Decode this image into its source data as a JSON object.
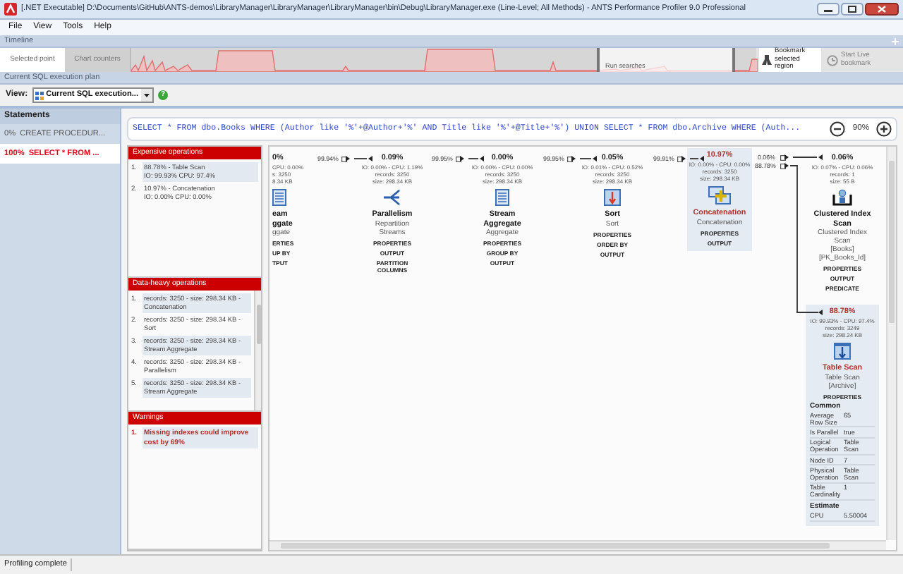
{
  "window": {
    "title": "[.NET Executable] D:\\Documents\\GitHub\\ANTS-demos\\LibraryManager\\LibraryManager\\LibraryManager\\bin\\Debug\\LibraryManager.exe (Line-Level; All Methods) - ANTS Performance Profiler 9.0 Professional"
  },
  "menu": [
    "File",
    "View",
    "Tools",
    "Help"
  ],
  "timeline": {
    "title": "Timeline",
    "tabs": [
      {
        "label": "Selected point",
        "selected": true
      },
      {
        "label": "Chart counters",
        "selected": false
      }
    ],
    "region_label": "Run searches",
    "buttons": [
      {
        "label": "Bookmark selected region",
        "disabled": false
      },
      {
        "label": "Start Live bookmark",
        "disabled": true
      }
    ]
  },
  "plan_title": "Current SQL execution plan",
  "view": {
    "label": "View:",
    "value": "Current SQL execution...",
    "help": "?"
  },
  "statements": {
    "title": "Statements",
    "items": [
      {
        "percent": "0%",
        "text": "CREATE PROCEDUR...",
        "selected": false
      },
      {
        "percent": "100%",
        "text": "SELECT * FROM ...",
        "selected": true
      }
    ]
  },
  "query": {
    "sql": "SELECT * FROM dbo.Books WHERE (Author like '%'+@Author+'%' AND Title like '%'+@Title+'%') UNION SELECT * FROM dbo.Archive WHERE (Auth...",
    "zoom": "90%"
  },
  "panels": [
    {
      "kind": "operations",
      "title": "Expensive operations",
      "items": [
        {
          "number": "1.",
          "text": "88.78% - Table Scan",
          "detail": "IO: 99.93% CPU: 97.4%"
        },
        {
          "number": "2.",
          "text": "10.97% - Concatenation",
          "detail": "IO: 0.00% CPU: 0.00%"
        }
      ]
    },
    {
      "kind": "scrolling",
      "title": "Data-heavy operations",
      "items": [
        {
          "number": "1.",
          "text": "records: 3250 - size: 298.34 KB -",
          "detail": "Concatenation"
        },
        {
          "number": "2.",
          "text": "records: 3250 - size: 298.34 KB -",
          "detail": "Sort"
        },
        {
          "number": "3.",
          "text": "records: 3250 - size: 298.34 KB -",
          "detail": "Stream Aggregate"
        },
        {
          "number": "4.",
          "text": "records: 3250 - size: 298.34 KB -",
          "detail": "Parallelism"
        },
        {
          "number": "5.",
          "text": "records: 3250 - size: 298.34 KB -",
          "detail": "Stream Aggregate"
        }
      ]
    },
    {
      "kind": "warnings",
      "title": "Warnings",
      "items": [
        {
          "number": "1.",
          "text": "Missing indexes could improve",
          "detail": "cost by 69%"
        }
      ]
    }
  ],
  "plan": {
    "links": [
      {
        "label": "99.94%"
      },
      {
        "label": "99.95%"
      },
      {
        "label": "99.95%"
      },
      {
        "label": "99.91%"
      },
      {
        "label": "0.06%"
      },
      {
        "label": "88.78%"
      }
    ],
    "nodes": [
      {
        "kind": "stream_aggregate",
        "cost": "0%",
        "costly": false,
        "highlighted": false,
        "stats": [
          "CPU: 0.00%",
          "s: 3250",
          "8.34 KB"
        ],
        "title": [
          "eam",
          "ggate"
        ],
        "subtitle": [
          "ggate"
        ],
        "sections": [
          "ERTIES",
          "UP BY",
          "TPUT"
        ]
      },
      {
        "kind": "parallelism",
        "cost": "0.09%",
        "costly": false,
        "highlighted": false,
        "stats": [
          "IO: 0.00% - CPU: 1.19%",
          "records: 3250",
          "size: 298.34 KB"
        ],
        "title": [
          "Parallelism"
        ],
        "subtitle": [
          "Repartition",
          "Streams"
        ],
        "sections": [
          "PROPERTIES",
          "OUTPUT",
          "PARTITION COLUMNS"
        ]
      },
      {
        "kind": "stream_aggregate",
        "cost": "0.00%",
        "costly": false,
        "highlighted": false,
        "stats": [
          "IO: 0.00% - CPU: 0.00%",
          "records: 3250",
          "size: 298.34 KB"
        ],
        "title": [
          "Stream",
          "Aggregate"
        ],
        "subtitle": [
          "Aggregate"
        ],
        "sections": [
          "PROPERTIES",
          "GROUP BY",
          "OUTPUT"
        ]
      },
      {
        "kind": "sort",
        "cost": "0.05%",
        "costly": false,
        "highlighted": false,
        "stats": [
          "IO: 0.01% - CPU: 0.52%",
          "records: 3250",
          "size: 298.34 KB"
        ],
        "title": [
          "Sort"
        ],
        "subtitle": [
          "Sort"
        ],
        "sections": [
          "PROPERTIES",
          "ORDER BY",
          "OUTPUT"
        ]
      },
      {
        "kind": "concatenation",
        "cost": "10.97%",
        "costly": true,
        "highlighted": true,
        "stats": [
          "IO: 0.00% - CPU: 0.00%",
          "records: 3250",
          "size: 298.34 KB"
        ],
        "title": [
          "Concatenation"
        ],
        "subtitle": [
          "Concatenation"
        ],
        "sections": [
          "PROPERTIES",
          "OUTPUT"
        ]
      },
      {
        "kind": "clustered_index_scan",
        "cost": "0.06%",
        "costly": false,
        "highlighted": false,
        "stats": [
          "IO: 0.07% - CPU: 0.06%",
          "records: 1",
          "size: 55 B"
        ],
        "title": [
          "Clustered Index",
          "Scan"
        ],
        "subtitle": [
          "Clustered Index",
          "Scan",
          "[Books]",
          "[PK_Books_Id]"
        ],
        "sections": [
          "PROPERTIES",
          "OUTPUT",
          "PREDICATE"
        ]
      },
      {
        "kind": "table_scan",
        "cost": "88.78%",
        "costly": true,
        "highlighted": true,
        "stats": [
          "IO: 99.93% - CPU: 97.4%",
          "records: 3249",
          "size: 298.24 KB"
        ],
        "title": [
          "Table Scan"
        ],
        "subtitle": [
          "Table Scan",
          "[Archive]"
        ],
        "sections": [
          "PROPERTIES"
        ],
        "properties": [
          {
            "title": "Common",
            "rows": [
              {
                "name": "Average Row Size",
                "value": "65"
              },
              {
                "name": "Is Parallel",
                "value": "true"
              },
              {
                "name": "Logical Operation",
                "value": "Table Scan"
              },
              {
                "name": "Node ID",
                "value": "7"
              },
              {
                "name": "Physical Operation",
                "value": "Table Scan"
              },
              {
                "name": "Table Cardinality",
                "value": "1"
              }
            ]
          },
          {
            "title": "Estimate",
            "rows": [
              {
                "name": "CPU",
                "value": "5.50004"
              }
            ]
          }
        ]
      }
    ]
  },
  "status_bar": "Profiling complete"
}
